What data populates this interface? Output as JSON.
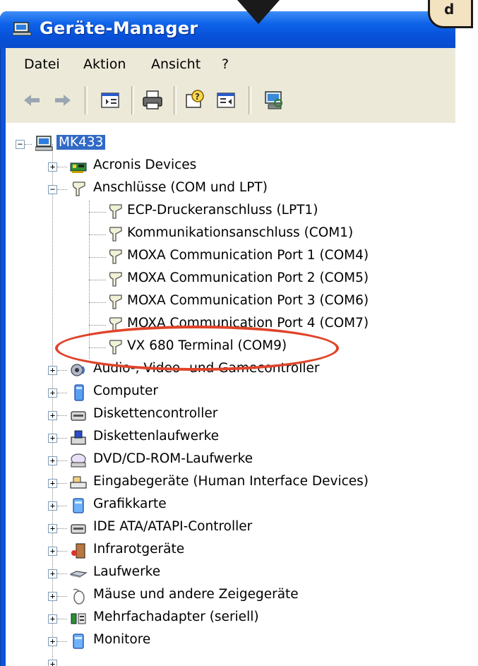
{
  "window": {
    "title": "Geräte-Manager"
  },
  "badge": "d",
  "menu": [
    "Datei",
    "Aktion",
    "Ansicht",
    "?"
  ],
  "toolbar_icons": [
    "back-icon",
    "forward-icon",
    "properties-icon",
    "print-icon",
    "help-icon",
    "toggle-pane-icon",
    "scan-hardware-icon"
  ],
  "tree": {
    "root": "MK433",
    "nodes": [
      {
        "label": "Acronis Devices",
        "icon": "card-icon"
      },
      {
        "label": "Anschlüsse (COM und LPT)",
        "icon": "port-icon",
        "expanded": true,
        "children": [
          "ECP-Druckeranschluss (LPT1)",
          "Kommunikationsanschluss (COM1)",
          "MOXA Communication Port 1 (COM4)",
          "MOXA Communication Port 2 (COM5)",
          "MOXA Communication Port 3 (COM6)",
          "MOXA Communication Port 4 (COM7)",
          "VX 680 Terminal (COM9)"
        ]
      },
      {
        "label": "Audio-, Video- und Gamecontroller",
        "icon": "audio-icon"
      },
      {
        "label": "Computer",
        "icon": "computer-icon"
      },
      {
        "label": "Diskettencontroller",
        "icon": "floppy-controller-icon"
      },
      {
        "label": "Diskettenlaufwerke",
        "icon": "floppy-drive-icon"
      },
      {
        "label": "DVD/CD-ROM-Laufwerke",
        "icon": "cdrom-icon"
      },
      {
        "label": "Eingabegeräte (Human Interface Devices)",
        "icon": "hid-icon"
      },
      {
        "label": "Grafikkarte",
        "icon": "display-adapter-icon"
      },
      {
        "label": "IDE ATA/ATAPI-Controller",
        "icon": "ide-icon"
      },
      {
        "label": "Infrarotgeräte",
        "icon": "infrared-icon"
      },
      {
        "label": "Laufwerke",
        "icon": "disk-drive-icon"
      },
      {
        "label": "Mäuse und andere Zeigegeräte",
        "icon": "mouse-icon"
      },
      {
        "label": "Mehrfachadapter (seriell)",
        "icon": "multiport-icon"
      },
      {
        "label": "Monitore",
        "icon": "monitor-icon"
      }
    ]
  },
  "colors": {
    "titlebar": "#0d62e8",
    "selection": "#316ac5",
    "highlight_ring": "#e0442a"
  }
}
